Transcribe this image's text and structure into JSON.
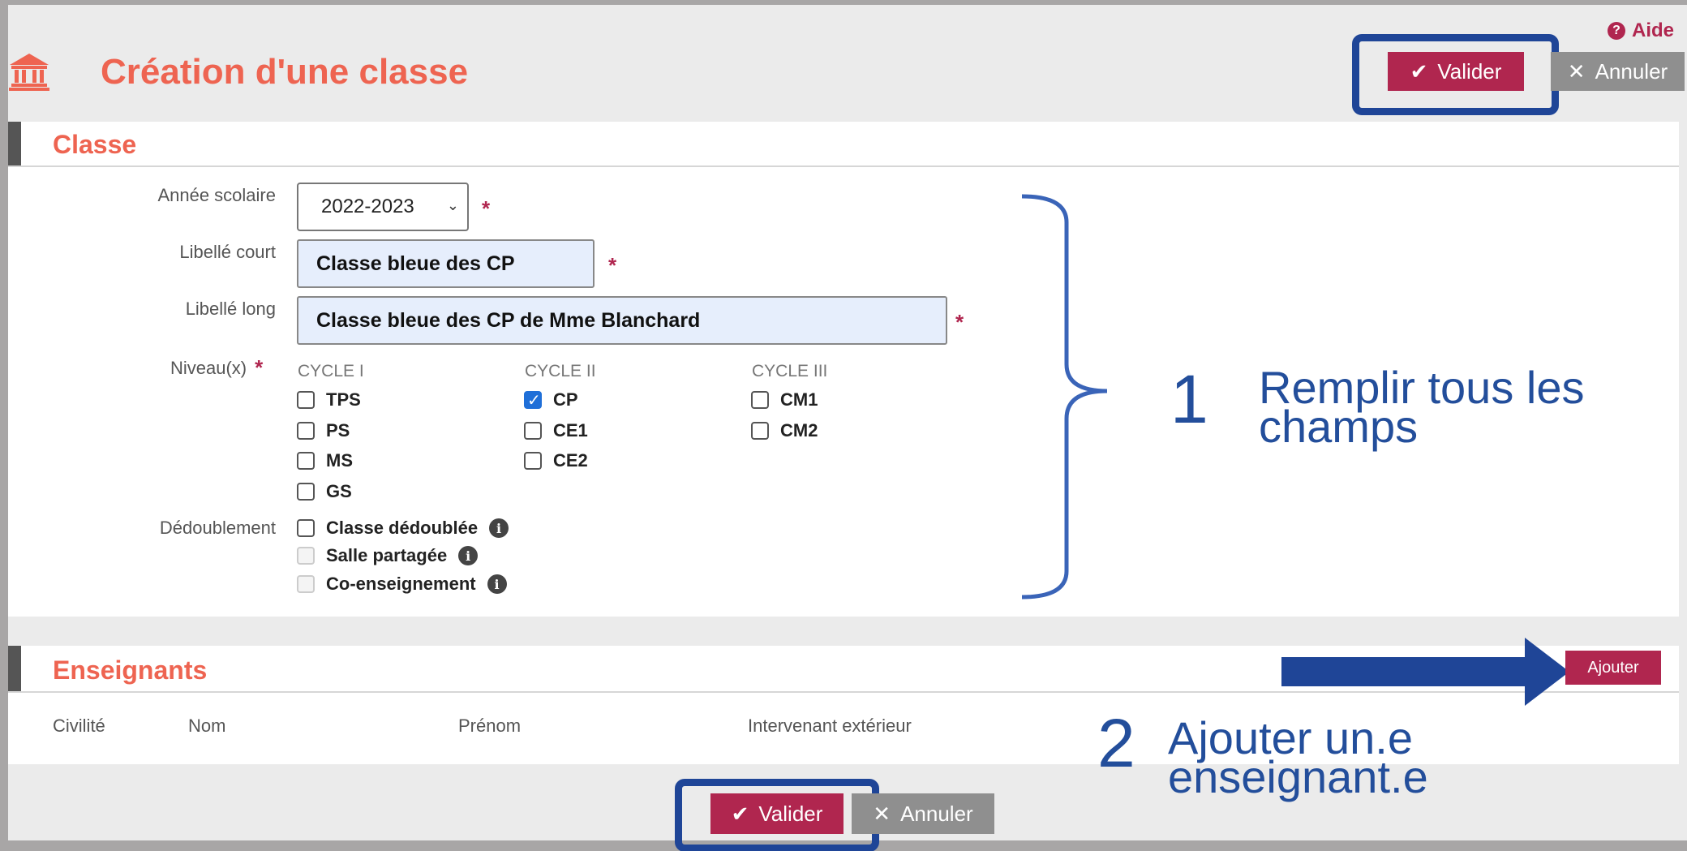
{
  "header": {
    "help_label": "Aide",
    "page_title": "Création d'une classe",
    "valider_label": "Valider",
    "annuler_label": "Annuler"
  },
  "classe": {
    "section_title": "Classe",
    "annee_label": "Année scolaire",
    "annee_value": "2022-2023",
    "libelle_court_label": "Libellé court",
    "libelle_court_value": "Classe bleue des CP",
    "libelle_long_label": "Libellé long",
    "libelle_long_value": "Classe bleue des CP de Mme Blanchard",
    "niveaux_label": "Niveau(x)",
    "required_mark": "*",
    "cycles": [
      {
        "title": "CYCLE I",
        "items": [
          {
            "label": "TPS",
            "checked": false
          },
          {
            "label": "PS",
            "checked": false
          },
          {
            "label": "MS",
            "checked": false
          },
          {
            "label": "GS",
            "checked": false
          }
        ]
      },
      {
        "title": "CYCLE II",
        "items": [
          {
            "label": "CP",
            "checked": true
          },
          {
            "label": "CE1",
            "checked": false
          },
          {
            "label": "CE2",
            "checked": false
          }
        ]
      },
      {
        "title": "CYCLE III",
        "items": [
          {
            "label": "CM1",
            "checked": false
          },
          {
            "label": "CM2",
            "checked": false
          }
        ]
      }
    ],
    "dedoublement_label": "Dédoublement",
    "dedoublement_options": [
      {
        "label": "Classe dédoublée",
        "disabled": false
      },
      {
        "label": "Salle partagée",
        "disabled": true
      },
      {
        "label": "Co-enseignement",
        "disabled": true
      }
    ]
  },
  "enseignants": {
    "section_title": "Enseignants",
    "ajouter_label": "Ajouter",
    "columns": [
      "Civilité",
      "Nom",
      "Prénom",
      "Intervenant extérieur"
    ]
  },
  "footer": {
    "valider_label": "Valider",
    "annuler_label": "Annuler"
  },
  "annotations": {
    "step1_number": "1",
    "step1_line1": "Remplir tous les",
    "step1_line2": "champs",
    "step2_number": "2",
    "step2_line1": "Ajouter un.e",
    "step2_line2": "enseignant.e"
  },
  "colors": {
    "accent": "#b0264f",
    "title": "#ee6451",
    "annotation": "#234e9b"
  }
}
